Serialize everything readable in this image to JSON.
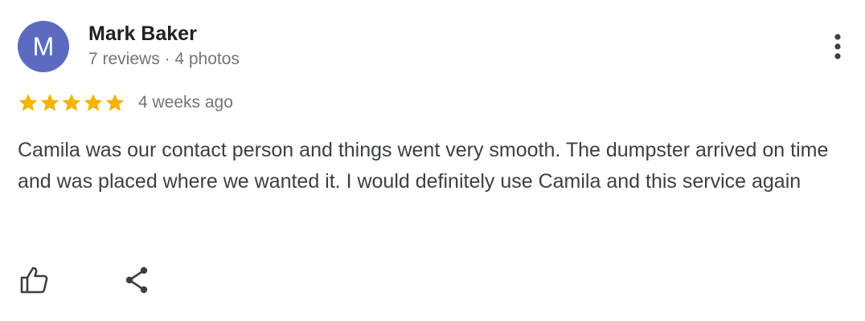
{
  "review": {
    "avatar_letter": "M",
    "reviewer_name": "Mark Baker",
    "reviewer_meta": "7 reviews · 4 photos",
    "rating": 5,
    "rating_max": 5,
    "date": "4 weeks ago",
    "text": "Camila was our contact person and things went very smooth. The dumpster arrived on time and was placed where we wanted it. I would definitely use Camila and this service again"
  },
  "icons": {
    "menu": "more-vert-icon",
    "like": "thumb-up-icon",
    "share": "share-icon",
    "star": "star-icon"
  },
  "colors": {
    "avatar_bg": "#5c6bc0",
    "star": "#f4b400",
    "meta_text": "#70757a",
    "icon": "#3c4043"
  }
}
